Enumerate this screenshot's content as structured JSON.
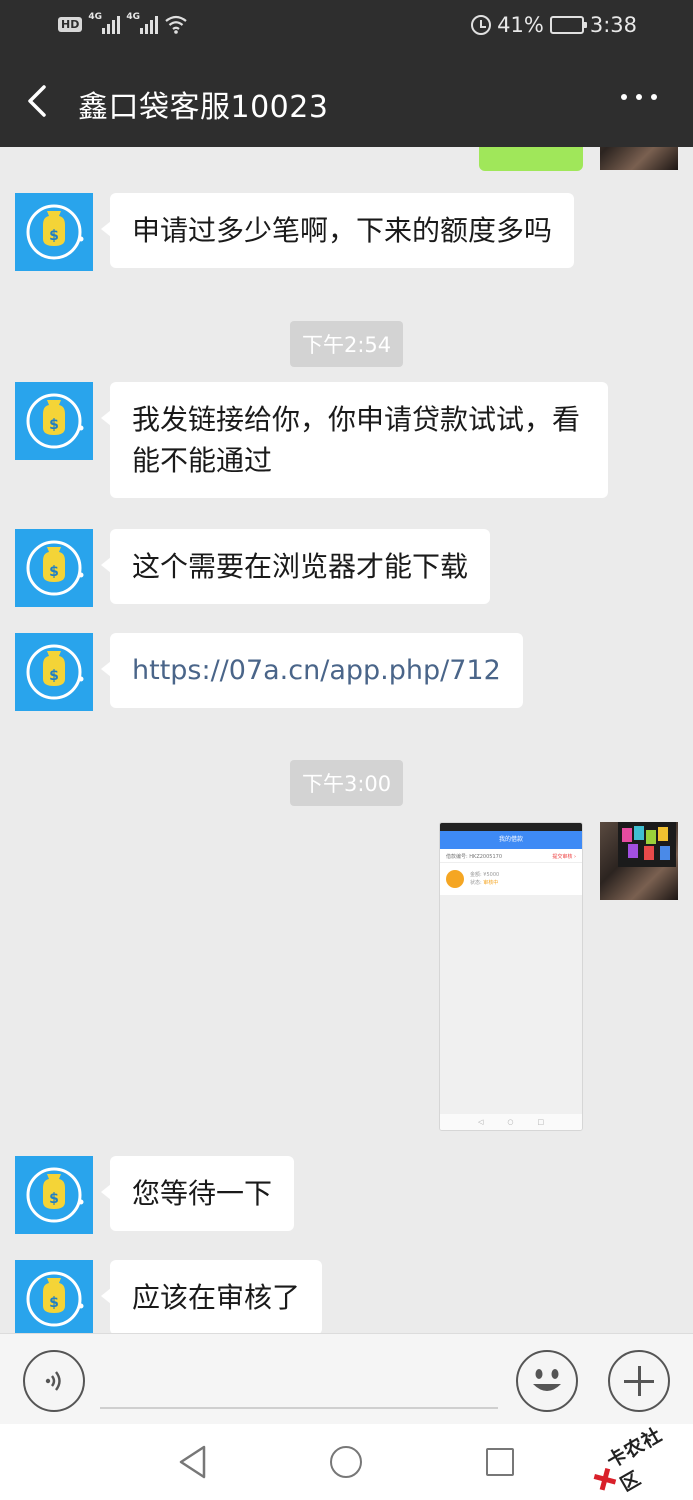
{
  "status_bar": {
    "hd": "HD",
    "net1": "4G",
    "net2": "4G",
    "battery_percent": "41%",
    "battery_level": 0.41,
    "time": "3:38"
  },
  "header": {
    "title": "鑫口袋客服10023"
  },
  "messages": [
    {
      "sender": "agent",
      "text": "申请过多少笔啊，下来的额度多吗"
    },
    {
      "type": "time",
      "text": "下午2:54"
    },
    {
      "sender": "agent",
      "text": "我发链接给你，你申请贷款试试，看能不能通过"
    },
    {
      "sender": "agent",
      "text": "这个需要在浏览器才能下载"
    },
    {
      "sender": "agent",
      "text": "https://07a.cn/app.php/712"
    },
    {
      "type": "time",
      "text": "下午3:00"
    },
    {
      "sender": "agent",
      "text": "您等待一下"
    },
    {
      "sender": "agent",
      "text": "应该在审核了"
    }
  ],
  "watermark": "卡农社区",
  "colors": {
    "header_bg": "#2e2e2e",
    "chat_bg": "#ebebeb",
    "agent_avatar": "#29a4ec",
    "self_bubble": "#a0e75a"
  }
}
